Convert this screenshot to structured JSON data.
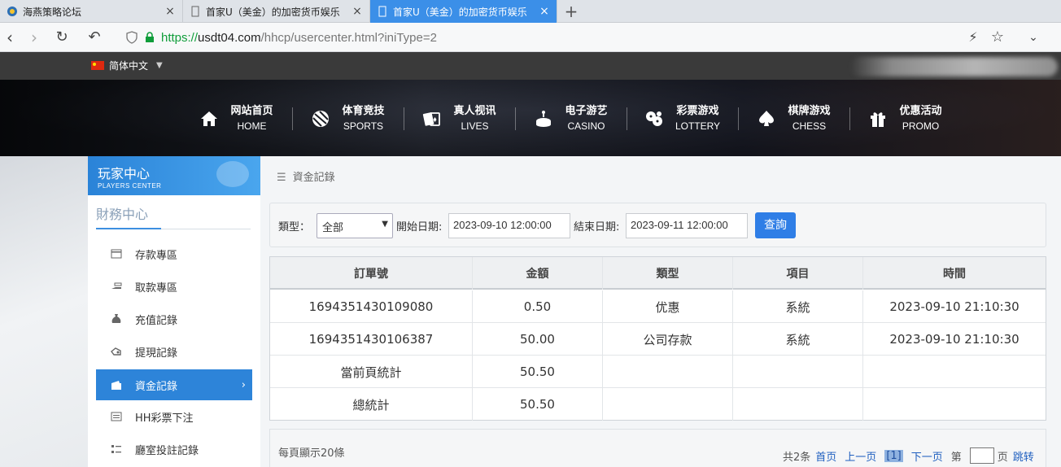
{
  "browser": {
    "tabs": [
      {
        "title": "海燕策略论坛",
        "active": false
      },
      {
        "title": "首家U（美金）的加密货币娱乐",
        "active": false
      },
      {
        "title": "首家U（美金）的加密货币娱乐",
        "active": true
      }
    ],
    "new_tab": "+",
    "url": {
      "scheme": "https://",
      "host": "usdt04.com",
      "path": "/hhcp/usercenter.html?iniType=2"
    }
  },
  "site": {
    "language": "简体中文",
    "menu": [
      {
        "cn": "网站首页",
        "en": "HOME",
        "icon": "home-icon"
      },
      {
        "cn": "体育竞技",
        "en": "SPORTS",
        "icon": "ball-icon"
      },
      {
        "cn": "真人视讯",
        "en": "LIVES",
        "icon": "cards-icon"
      },
      {
        "cn": "电子游艺",
        "en": "CASINO",
        "icon": "slot-icon"
      },
      {
        "cn": "彩票游戏",
        "en": "LOTTERY",
        "icon": "dice-icon"
      },
      {
        "cn": "棋牌游戏",
        "en": "CHESS",
        "icon": "spade-icon"
      },
      {
        "cn": "优惠活动",
        "en": "PROMO",
        "icon": "gift-icon"
      }
    ]
  },
  "sidebar": {
    "title_cn": "玩家中心",
    "title_en": "PLAYERS CENTER",
    "section": "財務中心",
    "items": [
      {
        "label": "存款專區",
        "icon": "deposit-icon",
        "active": false
      },
      {
        "label": "取款專區",
        "icon": "withdraw-icon",
        "active": false
      },
      {
        "label": "充值記錄",
        "icon": "moneybag-icon",
        "active": false
      },
      {
        "label": "提現記錄",
        "icon": "hand-icon",
        "active": false
      },
      {
        "label": "資金記錄",
        "icon": "wallet-icon",
        "active": true
      },
      {
        "label": "HH彩票下注",
        "icon": "ticket-icon",
        "active": false
      },
      {
        "label": "廳室投註記錄",
        "icon": "list-icon",
        "active": false
      }
    ]
  },
  "main": {
    "breadcrumb": "資金記錄",
    "filter": {
      "type_label": "類型：",
      "type_value": "全部",
      "start_label": "開始日期:",
      "start_value": "2023-09-10 12:00:00",
      "end_label": "結束日期:",
      "end_value": "2023-09-11 12:00:00",
      "query_label": "查詢"
    },
    "table": {
      "headers": [
        "訂單號",
        "金額",
        "類型",
        "項目",
        "時間"
      ],
      "rows": [
        [
          "1694351430109080",
          "0.50",
          "优惠",
          "系統",
          "2023-09-10 21:10:30"
        ],
        [
          "1694351430106387",
          "50.00",
          "公司存款",
          "系統",
          "2023-09-10 21:10:30"
        ],
        [
          "當前頁統計",
          "50.50",
          "",
          "",
          ""
        ],
        [
          "總統計",
          "50.50",
          "",
          "",
          ""
        ]
      ]
    },
    "pager": {
      "per_page": "每頁顯示20條",
      "total": "共2条",
      "first": "首页",
      "prev": "上一页",
      "current": "[1]",
      "next": "下一页",
      "page_prefix": "第",
      "page_suffix": "页",
      "jump": "跳转"
    }
  },
  "colors": {
    "accent": "#2f7ee6",
    "active_item": "#2d84d9",
    "https": "#0f9d3a"
  }
}
